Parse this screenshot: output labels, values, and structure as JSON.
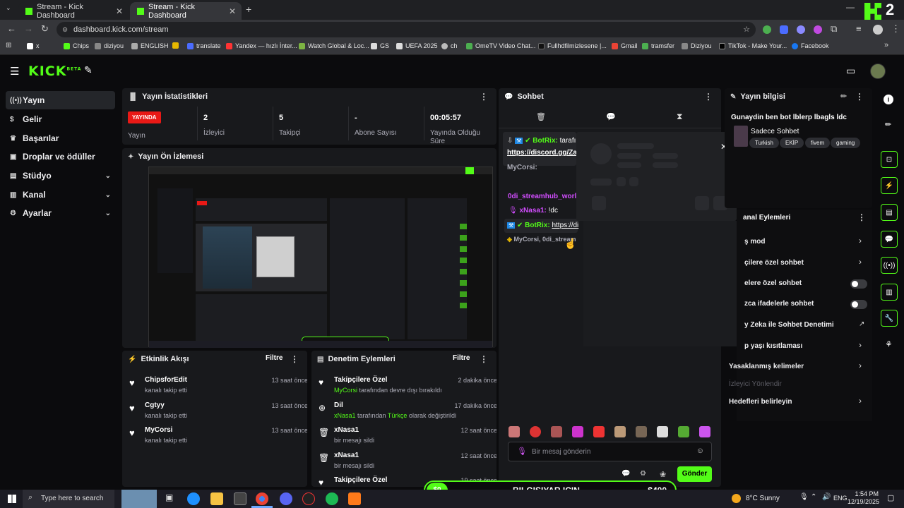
{
  "browser": {
    "tabs": [
      {
        "label": "Stream - Kick Dashboard",
        "active": false
      },
      {
        "label": "Stream - Kick Dashboard",
        "active": true
      }
    ],
    "url": "dashboard.kick.com/stream",
    "bookmarks": [
      "x",
      "Chips",
      "diziyou",
      "ENGLISH",
      "translate",
      "Yandex — hızlı İnter...",
      "Watch Global & Loc...",
      "GS",
      "UEFA 2025",
      "ch",
      "OmeTV Video Chat...",
      "Fullhdfilmizlesene |...",
      "Gmail",
      "tramsfer",
      "Diziyou",
      "TikTok - Make Your...",
      "Facebook"
    ],
    "corner_badge": "2"
  },
  "kick": {
    "logo": "KICK",
    "logo_badge": "BETA"
  },
  "sidebar": {
    "items": [
      {
        "label": "Yayın",
        "active": true,
        "icon": "broadcast-icon"
      },
      {
        "label": "Gelir",
        "icon": "money-icon"
      },
      {
        "label": "Başarılar",
        "icon": "trophy-icon"
      },
      {
        "label": "Droplar ve ödüller",
        "icon": "gift-icon"
      },
      {
        "label": "Stüdyo",
        "icon": "studio-icon",
        "expandable": true
      },
      {
        "label": "Kanal",
        "icon": "channel-icon",
        "expandable": true
      },
      {
        "label": "Ayarlar",
        "icon": "gear-icon",
        "expandable": true
      }
    ]
  },
  "stats": {
    "title": "Yayın İstatistikleri",
    "live": "YAYINDA",
    "live_label": "Yayın",
    "items": [
      {
        "value": "2",
        "label": "İzleyici"
      },
      {
        "value": "5",
        "label": "Takipçi"
      },
      {
        "value": "-",
        "label": "Abone Sayısı"
      },
      {
        "value": "00:05:57",
        "label": "Yayında Olduğu Süre"
      }
    ]
  },
  "preview": {
    "title": "Yayın Ön İzlemesi",
    "bottom_banner": "BILGISIYAR ICIN",
    "bottom_price": "$400"
  },
  "activity": {
    "title": "Etkinlik Akışı",
    "filter": "Filtre",
    "items": [
      {
        "name": "ChipsforEdit",
        "sub": "kanalı takip etti",
        "time": "13 saat önce"
      },
      {
        "name": "Cgtyy",
        "sub": "kanalı takip etti",
        "time": "13 saat önce"
      },
      {
        "name": "MyCorsi",
        "sub": "kanalı takip etti",
        "time": "13 saat önce"
      }
    ]
  },
  "moderation": {
    "title": "Denetim Eylemleri",
    "filter": "Filtre",
    "items": [
      {
        "name": "Takipçilere Özel",
        "actor": "MyCorsi",
        "sub": "tarafından devre dışı bırakıldı",
        "time": "2 dakika önce",
        "icon": "heart-icon"
      },
      {
        "name": "Dil",
        "actor": "xNasa1",
        "sub_pre": "tarafından",
        "lang": "Türkçe",
        "sub_post": "olarak değiştirildi",
        "time": "17 dakika önce",
        "icon": "globe-icon"
      },
      {
        "name": "xNasa1",
        "sub": "bir mesajı sildi",
        "time": "12 saat önce",
        "icon": "trash-icon"
      },
      {
        "name": "xNasa1",
        "sub": "bir mesajı sildi",
        "time": "12 saat önce",
        "icon": "trash-icon"
      },
      {
        "name": "Takipçilere Özel",
        "sub": "",
        "time": "19 saat önce",
        "icon": "heart-icon"
      }
    ]
  },
  "chat": {
    "title": "Sohbet",
    "messages": [
      {
        "user": "BotRix:",
        "text": "tarafında",
        "color": "#53fc18"
      },
      {
        "user": "",
        "text": "https://discord.gg/Za",
        "color": "#ffffff"
      },
      {
        "user": "MyCorsi:",
        "text": "",
        "color": "#adadb8"
      },
      {
        "user": "0di_streamhub_world:",
        "text": "",
        "color": "#d24dff"
      },
      {
        "user": "xNasa1:",
        "text": "!dc",
        "color": "#d24dff"
      },
      {
        "user": "BotRix:",
        "text": "https://di",
        "color": "#53fc18"
      },
      {
        "user": "MyCorsi, 0di_stream",
        "text": "",
        "color": "#adadb8"
      }
    ],
    "placeholder": "Bir mesaj gönderin",
    "send": "Gönder"
  },
  "stream_info": {
    "title": "Yayın bilgisi",
    "stream_title": "Gunaydin ben bot lblerp lbagls ldc",
    "category": "Sadece Sohbet",
    "tags": [
      "Turkish",
      "EKİP",
      "fivem",
      "gaming"
    ]
  },
  "channel_actions": {
    "title": "anal Eylemleri",
    "items": [
      {
        "label": "ş mod",
        "type": "chevron"
      },
      {
        "label": "çilere özel sohbet",
        "type": "chevron"
      },
      {
        "label": "elere özel sohbet",
        "type": "toggle"
      },
      {
        "label": "zca ifadelerle sohbet",
        "type": "toggle"
      },
      {
        "label": "y Zeka ile Sohbet Denetimi",
        "type": "external"
      },
      {
        "label": "p yaşı kısıtlaması",
        "type": "chevron"
      },
      {
        "label": "Yasaklanmış kelimeler",
        "type": "chevron"
      },
      {
        "label": "İzleyici Yönlendir",
        "type": "disabled"
      },
      {
        "label": "Hedefleri belirleyin",
        "type": "chevron"
      }
    ]
  },
  "goal_bar": {
    "start": "$0",
    "label": "BILGISIYAR ICIN",
    "target": "$400"
  },
  "taskbar": {
    "search": "Type here to search",
    "weather": "8°C  Sunny",
    "lang": "ENG",
    "time": "1:54 PM",
    "date": "12/19/2025"
  }
}
